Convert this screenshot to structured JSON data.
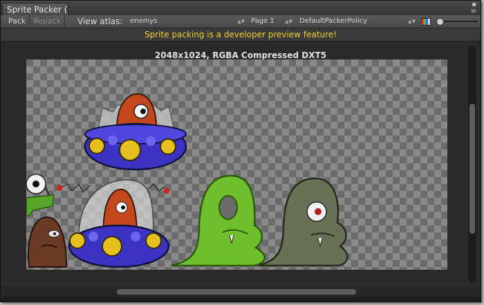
{
  "window": {
    "tab_title": "Sprite Packer (",
    "controls": [
      "▪",
      "≡"
    ]
  },
  "toolbar": {
    "pack_label": "Pack",
    "repack_label": "Repack",
    "view_atlas_label": "View atlas:",
    "atlas_value": "enemys",
    "page_value": "Page 1",
    "policy_value": "DefaultPackerPolicy",
    "color_mode_icon": "rgba-channels-icon"
  },
  "warning": {
    "text": "Sprite packing is a developer preview feature!",
    "color": "#f2cf2e"
  },
  "atlas": {
    "info": "2048x1024, RGBA Compressed DXT5"
  },
  "sprites": [
    {
      "name": "ufo-with-red-monster",
      "icon": "ufo-monster-sprite"
    },
    {
      "name": "eyeball-on-stalk",
      "icon": "eyeball-sprite"
    },
    {
      "name": "green-grass-tuft",
      "icon": "grass-sprite"
    },
    {
      "name": "brown-blob-monster",
      "icon": "brown-blob-sprite"
    },
    {
      "name": "ufo-with-dome-monster",
      "icon": "ufo-dome-sprite"
    },
    {
      "name": "green-slime-monster",
      "icon": "green-slime-sprite"
    },
    {
      "name": "gray-zombie-slime",
      "icon": "gray-slime-sprite"
    }
  ]
}
